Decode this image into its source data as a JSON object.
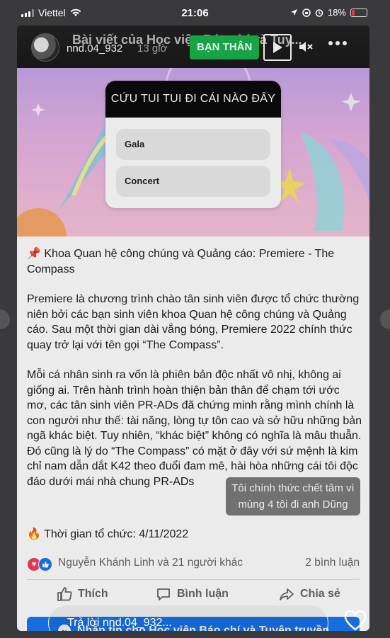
{
  "status_bar": {
    "carrier": "Viettel",
    "time": "21:06",
    "battery": "18%"
  },
  "story": {
    "header_title": "Bài viết của Học viện Báo chí và Tuy...",
    "username": "nnd.04_932",
    "time_ago": "13 giờ",
    "badge": "BẠN THÂN"
  },
  "post": {
    "poll": {
      "title": "CỨU TUI TUI ĐI CÁI NÀO ĐÂY",
      "options": [
        "Gala",
        "Concert"
      ]
    },
    "heading_emoji": "📌",
    "heading": "Khoa Quan hệ công chúng và Quảng cáo: Premiere - The Compass",
    "paragraph_1": "Premiere là chương trình chào tân sinh viên được tổ chức thường niên bởi các bạn sinh viên khoa Quan hệ công chúng và Quảng cáo. Sau một thời gian dài vắng bóng, Premiere 2022 chính thức quay trở lại với tên gọi “The Compass”.",
    "paragraph_2": "Mỗi cá nhân sinh ra vốn là phiên bản độc nhất vô nhị, không ai giống ai. Trên hành trình hoàn thiện bản thân để chạm tới ước mơ, các tân sinh viên PR-ADs đã chứng minh rằng mình chính là con người như thế: tài năng, lòng tự tôn cao và sở hữu những bản ngã khác biệt. Tuy nhiên, “khác biệt” không có nghĩa là mâu thuẫn. Đó cũng là lý do “The Compass” có mặt ở đây với sứ mệnh là kim chỉ nam dẫn dắt K42 theo đuổi đam mê, hài hòa những cái tôi độc đáo dưới mái nhà chung PR-ADs",
    "event_emoji": "🔥",
    "event_time": "Thời gian tổ chức: 4/11/2022",
    "reactions_text": "Nguyễn Khánh Linh và 21 người khác",
    "comments_count": "2 bình luận",
    "actions": {
      "like": "Thích",
      "comment": "Bình luận",
      "share": "Chia sẻ"
    },
    "message_button": "Nhắn tin cho Học viện Báo chí và Tuyên truyền"
  },
  "sticker_text": "Tôi chính thức chết tâm vì mùng 4 tôi đi anh Dũng",
  "reply": {
    "placeholder": "Trả lời nnd.04_932..."
  },
  "colors": {
    "friend_badge": "#1ab24a",
    "facebook_blue": "#1877f2",
    "love": "#f33e58"
  }
}
